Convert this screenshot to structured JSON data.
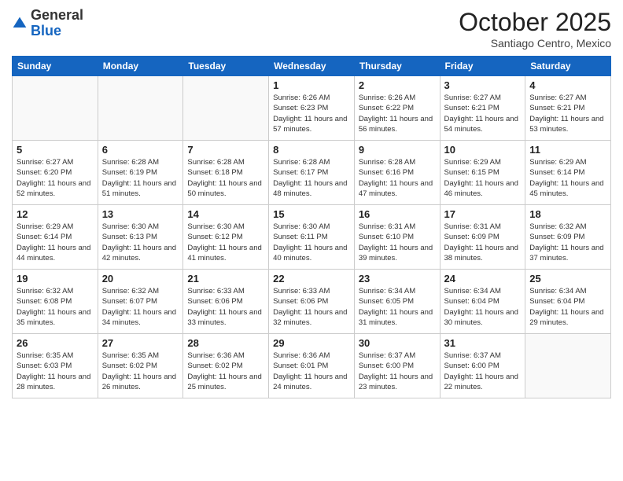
{
  "header": {
    "logo_general": "General",
    "logo_blue": "Blue",
    "month_title": "October 2025",
    "location": "Santiago Centro, Mexico"
  },
  "weekdays": [
    "Sunday",
    "Monday",
    "Tuesday",
    "Wednesday",
    "Thursday",
    "Friday",
    "Saturday"
  ],
  "weeks": [
    [
      {
        "day": "",
        "info": ""
      },
      {
        "day": "",
        "info": ""
      },
      {
        "day": "",
        "info": ""
      },
      {
        "day": "1",
        "info": "Sunrise: 6:26 AM\nSunset: 6:23 PM\nDaylight: 11 hours and 57 minutes."
      },
      {
        "day": "2",
        "info": "Sunrise: 6:26 AM\nSunset: 6:22 PM\nDaylight: 11 hours and 56 minutes."
      },
      {
        "day": "3",
        "info": "Sunrise: 6:27 AM\nSunset: 6:21 PM\nDaylight: 11 hours and 54 minutes."
      },
      {
        "day": "4",
        "info": "Sunrise: 6:27 AM\nSunset: 6:21 PM\nDaylight: 11 hours and 53 minutes."
      }
    ],
    [
      {
        "day": "5",
        "info": "Sunrise: 6:27 AM\nSunset: 6:20 PM\nDaylight: 11 hours and 52 minutes."
      },
      {
        "day": "6",
        "info": "Sunrise: 6:28 AM\nSunset: 6:19 PM\nDaylight: 11 hours and 51 minutes."
      },
      {
        "day": "7",
        "info": "Sunrise: 6:28 AM\nSunset: 6:18 PM\nDaylight: 11 hours and 50 minutes."
      },
      {
        "day": "8",
        "info": "Sunrise: 6:28 AM\nSunset: 6:17 PM\nDaylight: 11 hours and 48 minutes."
      },
      {
        "day": "9",
        "info": "Sunrise: 6:28 AM\nSunset: 6:16 PM\nDaylight: 11 hours and 47 minutes."
      },
      {
        "day": "10",
        "info": "Sunrise: 6:29 AM\nSunset: 6:15 PM\nDaylight: 11 hours and 46 minutes."
      },
      {
        "day": "11",
        "info": "Sunrise: 6:29 AM\nSunset: 6:14 PM\nDaylight: 11 hours and 45 minutes."
      }
    ],
    [
      {
        "day": "12",
        "info": "Sunrise: 6:29 AM\nSunset: 6:14 PM\nDaylight: 11 hours and 44 minutes."
      },
      {
        "day": "13",
        "info": "Sunrise: 6:30 AM\nSunset: 6:13 PM\nDaylight: 11 hours and 42 minutes."
      },
      {
        "day": "14",
        "info": "Sunrise: 6:30 AM\nSunset: 6:12 PM\nDaylight: 11 hours and 41 minutes."
      },
      {
        "day": "15",
        "info": "Sunrise: 6:30 AM\nSunset: 6:11 PM\nDaylight: 11 hours and 40 minutes."
      },
      {
        "day": "16",
        "info": "Sunrise: 6:31 AM\nSunset: 6:10 PM\nDaylight: 11 hours and 39 minutes."
      },
      {
        "day": "17",
        "info": "Sunrise: 6:31 AM\nSunset: 6:09 PM\nDaylight: 11 hours and 38 minutes."
      },
      {
        "day": "18",
        "info": "Sunrise: 6:32 AM\nSunset: 6:09 PM\nDaylight: 11 hours and 37 minutes."
      }
    ],
    [
      {
        "day": "19",
        "info": "Sunrise: 6:32 AM\nSunset: 6:08 PM\nDaylight: 11 hours and 35 minutes."
      },
      {
        "day": "20",
        "info": "Sunrise: 6:32 AM\nSunset: 6:07 PM\nDaylight: 11 hours and 34 minutes."
      },
      {
        "day": "21",
        "info": "Sunrise: 6:33 AM\nSunset: 6:06 PM\nDaylight: 11 hours and 33 minutes."
      },
      {
        "day": "22",
        "info": "Sunrise: 6:33 AM\nSunset: 6:06 PM\nDaylight: 11 hours and 32 minutes."
      },
      {
        "day": "23",
        "info": "Sunrise: 6:34 AM\nSunset: 6:05 PM\nDaylight: 11 hours and 31 minutes."
      },
      {
        "day": "24",
        "info": "Sunrise: 6:34 AM\nSunset: 6:04 PM\nDaylight: 11 hours and 30 minutes."
      },
      {
        "day": "25",
        "info": "Sunrise: 6:34 AM\nSunset: 6:04 PM\nDaylight: 11 hours and 29 minutes."
      }
    ],
    [
      {
        "day": "26",
        "info": "Sunrise: 6:35 AM\nSunset: 6:03 PM\nDaylight: 11 hours and 28 minutes."
      },
      {
        "day": "27",
        "info": "Sunrise: 6:35 AM\nSunset: 6:02 PM\nDaylight: 11 hours and 26 minutes."
      },
      {
        "day": "28",
        "info": "Sunrise: 6:36 AM\nSunset: 6:02 PM\nDaylight: 11 hours and 25 minutes."
      },
      {
        "day": "29",
        "info": "Sunrise: 6:36 AM\nSunset: 6:01 PM\nDaylight: 11 hours and 24 minutes."
      },
      {
        "day": "30",
        "info": "Sunrise: 6:37 AM\nSunset: 6:00 PM\nDaylight: 11 hours and 23 minutes."
      },
      {
        "day": "31",
        "info": "Sunrise: 6:37 AM\nSunset: 6:00 PM\nDaylight: 11 hours and 22 minutes."
      },
      {
        "day": "",
        "info": ""
      }
    ]
  ]
}
